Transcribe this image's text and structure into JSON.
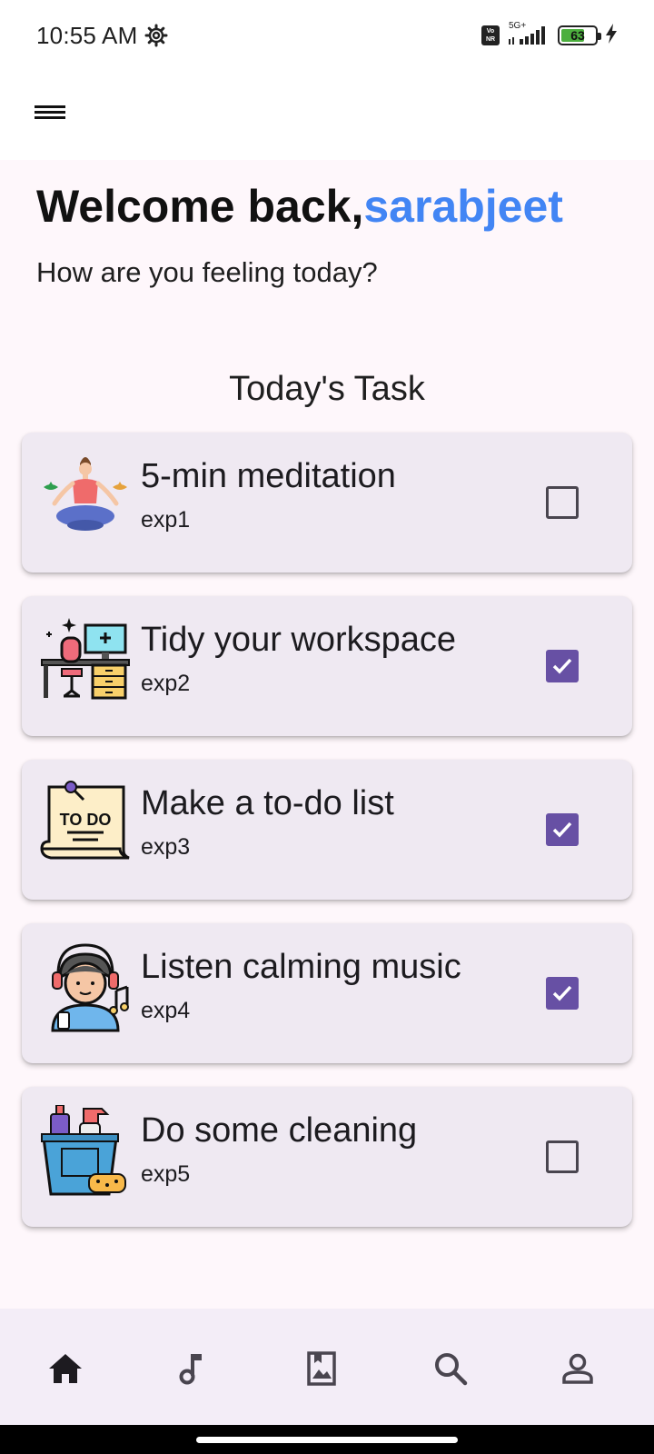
{
  "status_bar": {
    "time": "10:55 AM",
    "network": "5G+",
    "volte": "Vo NR",
    "battery": "63",
    "icons": [
      "gear-icon",
      "volte-icon",
      "signal-icon",
      "battery-icon",
      "charging-icon"
    ]
  },
  "app_bar": {
    "menu_icon": "menu-icon"
  },
  "header": {
    "greeting": "Welcome back,",
    "username": "sarabjeet",
    "subtitle": "How are you feeling today?",
    "username_color": "#4285f4"
  },
  "tasks_section": {
    "title": "Today's Task",
    "items": [
      {
        "title": "5-min meditation",
        "subtitle": "exp1",
        "checked": false,
        "image": "meditation-illustration"
      },
      {
        "title": "Tidy your workspace",
        "subtitle": "exp2",
        "checked": true,
        "image": "workspace-illustration"
      },
      {
        "title": "Make a to-do list",
        "subtitle": "exp3",
        "checked": true,
        "image": "todo-list-illustration",
        "image_text": "TO DO"
      },
      {
        "title": "Listen calming music",
        "subtitle": "exp4",
        "checked": true,
        "image": "music-listener-illustration"
      },
      {
        "title": "Do some cleaning",
        "subtitle": "exp5",
        "checked": false,
        "image": "cleaning-supplies-illustration"
      }
    ]
  },
  "bottom_nav": {
    "items": [
      {
        "icon": "home-icon",
        "active": true
      },
      {
        "icon": "music-note-icon",
        "active": false
      },
      {
        "icon": "bookmark-image-icon",
        "active": false
      },
      {
        "icon": "search-icon",
        "active": false
      },
      {
        "icon": "profile-icon",
        "active": false
      }
    ]
  },
  "colors": {
    "accent": "#6750a4",
    "card_background": "#efe9f2",
    "page_background": "#fef7fb",
    "nav_background": "#f3edf7"
  }
}
